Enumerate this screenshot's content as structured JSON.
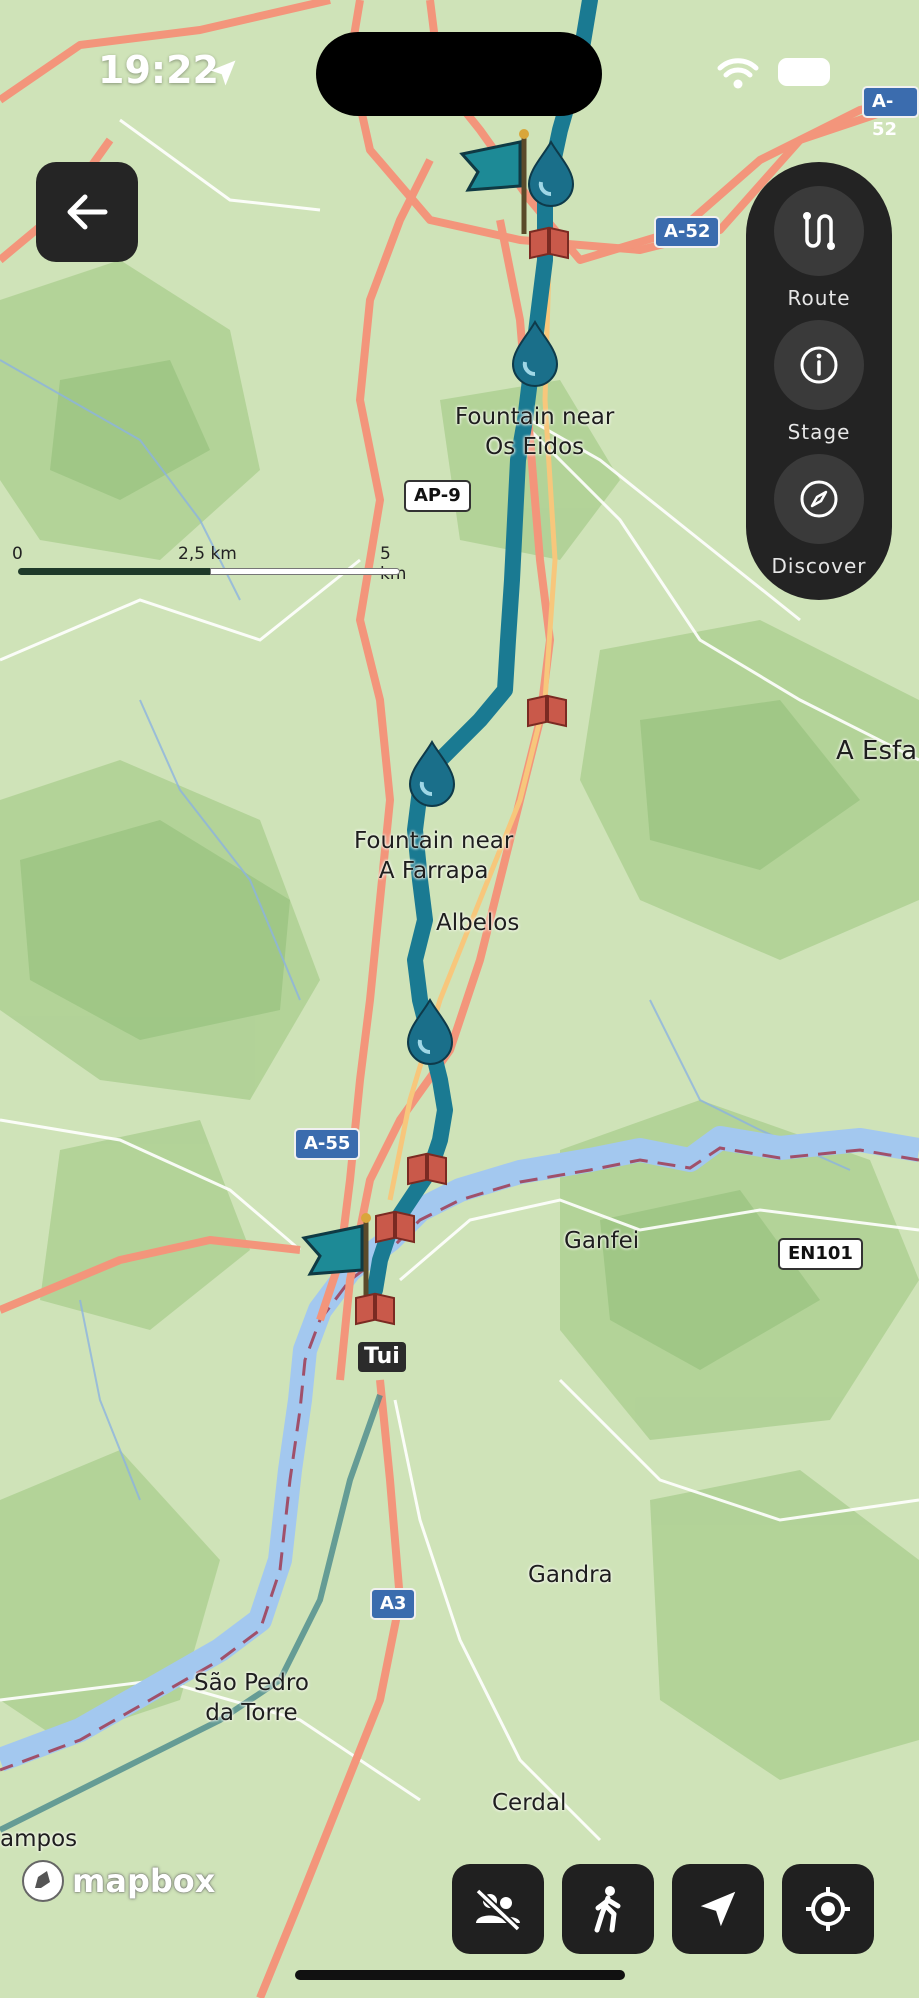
{
  "status_bar": {
    "time": "19:22"
  },
  "back_button": {
    "icon": "arrow-left-icon"
  },
  "side_panel": {
    "items": [
      {
        "label": "Route",
        "icon": "route-icon"
      },
      {
        "label": "Stage",
        "icon": "info-icon"
      },
      {
        "label": "Discover",
        "icon": "compass-icon"
      }
    ]
  },
  "scale_bar": {
    "labels": [
      "0",
      "2,5 km",
      "5 km"
    ]
  },
  "map": {
    "places": [
      {
        "lines": [
          "Fountain near",
          "Os Eidos"
        ]
      },
      {
        "lines": [
          "Fountain near",
          "A Farrapa"
        ]
      },
      {
        "lines": [
          "Albelos"
        ]
      },
      {
        "lines": [
          "A Esfa"
        ]
      },
      {
        "lines": [
          "Ganfei"
        ]
      },
      {
        "lines": [
          "Gandra"
        ]
      },
      {
        "lines": [
          "São Pedro",
          "da Torre"
        ]
      },
      {
        "lines": [
          "Cerdal"
        ]
      },
      {
        "lines": [
          "ampos"
        ]
      }
    ],
    "town": "Tui",
    "road_shields": [
      "A-52",
      "A-52",
      "AP-9",
      "A-55",
      "EN101",
      "A3"
    ],
    "attribution": "mapbox",
    "colors": {
      "route": "#1a7a92",
      "river": "#a3c8ef",
      "motorway": "#f3957b",
      "land": "#cfe3b8"
    }
  },
  "bottom_controls": [
    {
      "icon": "hide-people-icon"
    },
    {
      "icon": "walking-person-icon"
    },
    {
      "icon": "navigation-arrow-icon"
    },
    {
      "icon": "locate-me-icon"
    }
  ]
}
